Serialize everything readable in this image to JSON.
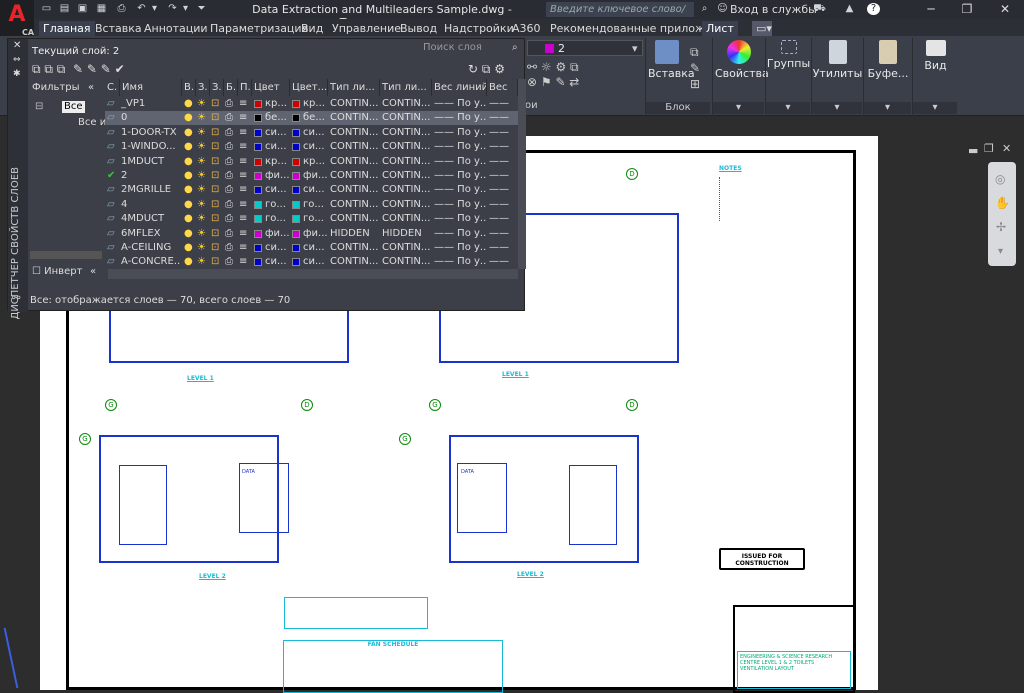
{
  "app": {
    "logo": "A",
    "logo_sub": "CAD",
    "title": "Data Extraction and Multileaders Sample.dwg - Только чтение",
    "search_placeholder": "Введите ключевое слово/фразу",
    "signin": "Вход в службы",
    "minimize": "─",
    "maximize": "❐",
    "close": "✕"
  },
  "menu": [
    "Главная",
    "Вставка",
    "Аннотации",
    "Параметризация",
    "Вид",
    "Управление",
    "Вывод",
    "Надстройки",
    "A360",
    "Рекомендованные приложения",
    "Лист"
  ],
  "ribbon": {
    "layer_current": "2",
    "insert_label": "Вставка",
    "block_label": "Блок",
    "props_label": "Свойства",
    "groups_label": "Группы",
    "utils_label": "Утилиты",
    "clipboard_label": "Буфе...",
    "view_label": "Вид",
    "layers_label": "ои"
  },
  "layers_panel": {
    "current_layer": "Текущий слой: 2",
    "search_placeholder": "Поиск слоя",
    "filters_label": "Фильтры",
    "tree_all": "Все",
    "tree_used": "Все и",
    "invert_label": "Инверт",
    "side_title": "ДИСПЕТЧЕР СВОЙСТВ СЛОЕВ",
    "status": "Все: отображается слоев — 70, всего слоев — 70",
    "columns": [
      "С.",
      "Имя",
      "В.",
      "З.",
      "З.",
      "Б.",
      "П.",
      "Цвет",
      "Цвет...",
      "Тип ли...",
      "Тип ли...",
      "Вес линий",
      "Вес"
    ],
    "rows": [
      {
        "name": "_VP1",
        "color": "кр...",
        "color2": "кр...",
        "lt": "CONTIN...",
        "lt2": "CONTIN...",
        "lw": "—— По у...",
        "c": "#d00000",
        "c2": "#d00000",
        "cur": false,
        "sel": false
      },
      {
        "name": "0",
        "color": "бе...",
        "color2": "бе...",
        "lt": "CONTIN...",
        "lt2": "CONTIN...",
        "lw": "—— По у...",
        "c": "#000000",
        "c2": "#000000",
        "cur": false,
        "sel": true
      },
      {
        "name": "1-DOOR-TX",
        "color": "си...",
        "color2": "си...",
        "lt": "CONTIN...",
        "lt2": "CONTIN...",
        "lw": "—— По у...",
        "c": "#0000cc",
        "c2": "#0000cc",
        "cur": false,
        "sel": false
      },
      {
        "name": "1-WINDO...",
        "color": "си...",
        "color2": "си...",
        "lt": "CONTIN...",
        "lt2": "CONTIN...",
        "lw": "—— По у...",
        "c": "#0000cc",
        "c2": "#0000cc",
        "cur": false,
        "sel": false
      },
      {
        "name": "1MDUCT",
        "color": "кр...",
        "color2": "кр...",
        "lt": "CONTIN...",
        "lt2": "CONTIN...",
        "lw": "—— По у...",
        "c": "#d00000",
        "c2": "#d00000",
        "cur": false,
        "sel": false
      },
      {
        "name": "2",
        "color": "фи...",
        "color2": "фи...",
        "lt": "CONTIN...",
        "lt2": "CONTIN...",
        "lw": "—— По у...",
        "c": "#cc00cc",
        "c2": "#cc00cc",
        "cur": true,
        "sel": false
      },
      {
        "name": "2MGRILLE",
        "color": "си...",
        "color2": "си...",
        "lt": "CONTIN...",
        "lt2": "CONTIN...",
        "lw": "—— По у...",
        "c": "#0000cc",
        "c2": "#0000cc",
        "cur": false,
        "sel": false
      },
      {
        "name": "4",
        "color": "го...",
        "color2": "го...",
        "lt": "CONTIN...",
        "lt2": "CONTIN...",
        "lw": "—— По у...",
        "c": "#00cccc",
        "c2": "#00cccc",
        "cur": false,
        "sel": false
      },
      {
        "name": "4MDUCT",
        "color": "го...",
        "color2": "го...",
        "lt": "CONTIN...",
        "lt2": "CONTIN...",
        "lw": "—— По у...",
        "c": "#00cccc",
        "c2": "#00cccc",
        "cur": false,
        "sel": false
      },
      {
        "name": "6MFLEX",
        "color": "фи...",
        "color2": "фи...",
        "lt": "HIDDEN",
        "lt2": "HIDDEN",
        "lw": "—— По у...",
        "c": "#cc00cc",
        "c2": "#cc00cc",
        "cur": false,
        "sel": false
      },
      {
        "name": "A-CEILING",
        "color": "си...",
        "color2": "си...",
        "lt": "CONTIN...",
        "lt2": "CONTIN...",
        "lw": "—— По у...",
        "c": "#0000cc",
        "c2": "#0000cc",
        "cur": false,
        "sel": false
      },
      {
        "name": "A-CONCRE...",
        "color": "си...",
        "color2": "си...",
        "lt": "CONTIN...",
        "lt2": "CONTIN...",
        "lw": "—— По у...",
        "c": "#0000cc",
        "c2": "#0000cc",
        "cur": false,
        "sel": false
      }
    ]
  },
  "drawing": {
    "notes_title": "NOTES",
    "level1a": "LEVEL 1",
    "level1b": "LEVEL 1",
    "level2a": "LEVEL 2",
    "level2b": "LEVEL 2",
    "issued": "ISSUED FOR CONSTRUCTION",
    "fan_schedule": "FAN SCHEDULE",
    "title_block": "ENGINEERING & SCIENCE RESEARCH CENTRE LEVEL 1 & 2 TOILETS VENTILATION LAYOUT",
    "data_label": "DATA",
    "grid_marks": [
      "G",
      "D",
      "G",
      "D"
    ]
  }
}
